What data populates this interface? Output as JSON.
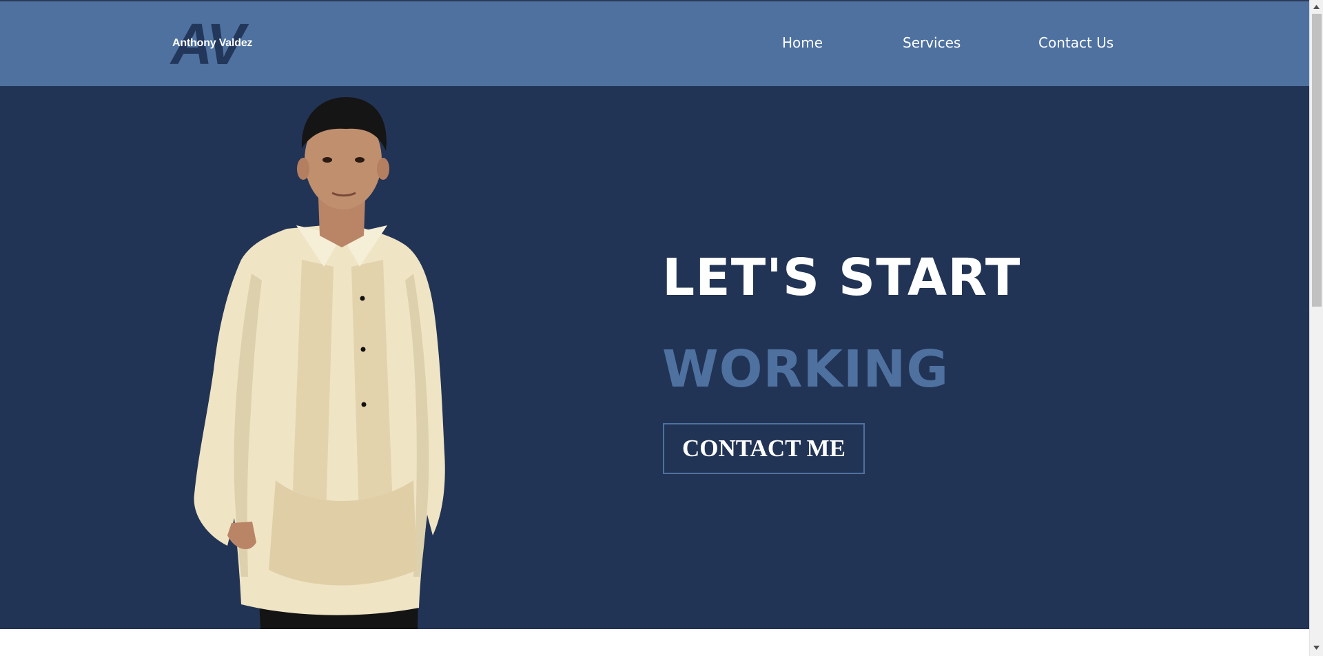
{
  "header": {
    "logo_monogram": "AV",
    "logo_name": "Anthony Valdez",
    "nav": [
      {
        "label": "Home"
      },
      {
        "label": "Services"
      },
      {
        "label": "Contact Us"
      }
    ]
  },
  "hero": {
    "headline_line1": "LET'S START",
    "headline_line2": "WORKING",
    "cta_label": "CONTACT ME",
    "photo_description": "portrait-photo"
  },
  "colors": {
    "nav_bg": "#4e71a0",
    "hero_bg": "#223455",
    "accent": "#4e71a0",
    "text": "#ffffff"
  },
  "icons": {
    "scroll_up": "triangle-up-icon",
    "scroll_down": "triangle-down-icon"
  }
}
